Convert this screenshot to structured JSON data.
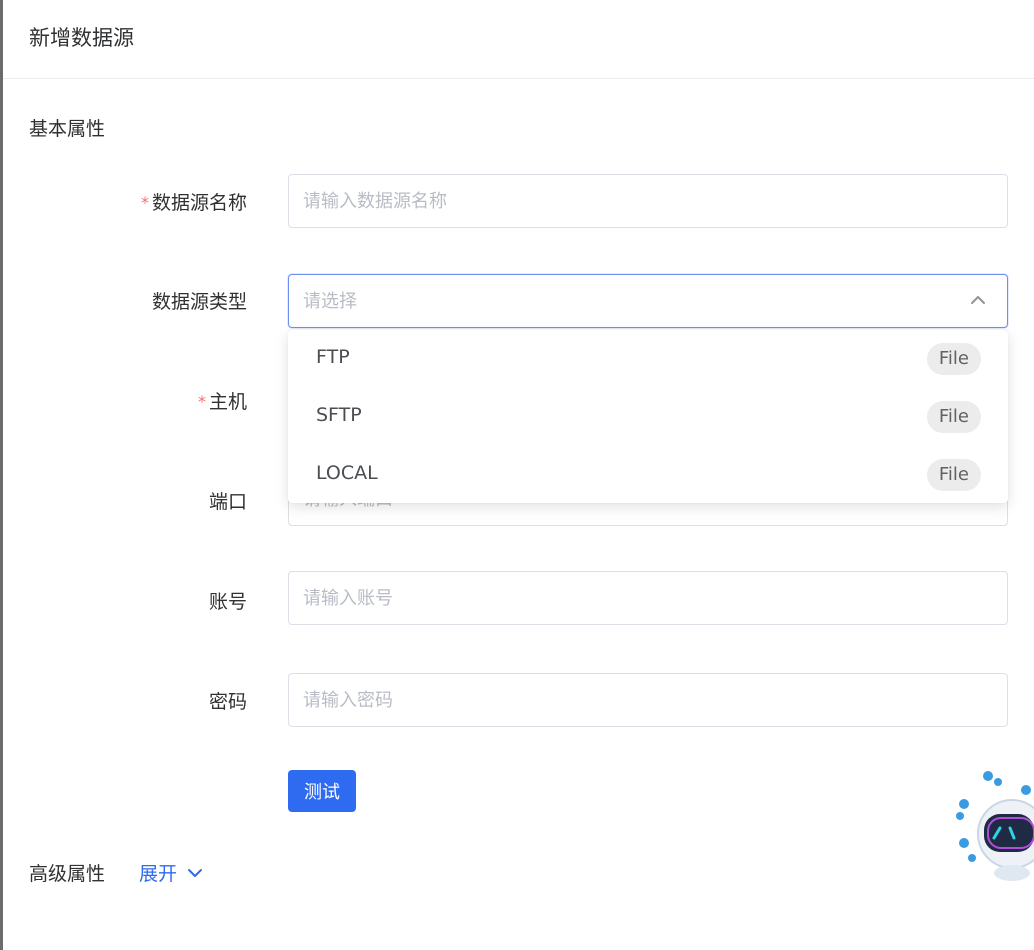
{
  "header": {
    "title": "新增数据源"
  },
  "basic_section": {
    "title": "基本属性"
  },
  "form": {
    "name": {
      "label": "数据源名称",
      "required_mark": "*",
      "placeholder": "请输入数据源名称"
    },
    "type": {
      "label": "数据源类型",
      "placeholder": "请选择"
    },
    "host": {
      "label": "主机",
      "required_mark": "*"
    },
    "port": {
      "label": "端口",
      "placeholder": "请输入端口"
    },
    "account": {
      "label": "账号",
      "placeholder": "请输入账号"
    },
    "password": {
      "label": "密码",
      "placeholder": "请输入密码"
    }
  },
  "dropdown": {
    "options": [
      {
        "label": "FTP",
        "tag": "File"
      },
      {
        "label": "SFTP",
        "tag": "File"
      },
      {
        "label": "LOCAL",
        "tag": "File"
      }
    ]
  },
  "actions": {
    "test_label": "测试"
  },
  "advanced": {
    "title": "高级属性",
    "toggle_label": "展开"
  },
  "colors": {
    "primary": "#2f6bf0",
    "required": "#f56c6c",
    "focus_border": "#6c8ff2"
  }
}
